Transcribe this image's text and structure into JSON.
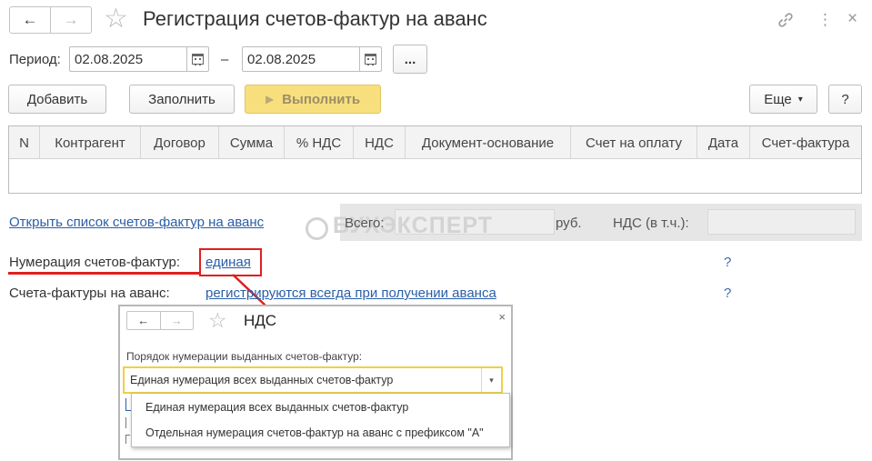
{
  "window": {
    "title": "Регистрация счетов-фактур на аванс",
    "back_icon": "←",
    "forward_icon": "→",
    "favorite_icon": "☆",
    "link_icon": "🔗",
    "more_icon": "⋮",
    "close_icon": "×"
  },
  "period": {
    "label": "Период:",
    "from": "02.08.2025",
    "separator": "–",
    "to": "02.08.2025",
    "select_button": "..."
  },
  "toolbar": {
    "add": "Добавить",
    "fill": "Заполнить",
    "run": "Выполнить",
    "run_icon": "▶",
    "more": "Еще",
    "more_arrow": "▾",
    "help": "?"
  },
  "table": {
    "columns": [
      "N",
      "Контрагент",
      "Договор",
      "Сумма",
      "% НДС",
      "НДС",
      "Документ-основание",
      "Счет на оплату",
      "Дата",
      "Счет-фактура"
    ],
    "rows": []
  },
  "open_list_link": "Открыть список счетов-фактур на аванс",
  "totals": {
    "total_label": "Всего:",
    "currency": "руб.",
    "vat_label": "НДС (в т.ч.):"
  },
  "watermark": "БУХЭКСПЕРТ",
  "numbering": {
    "label": "Нумерация счетов-фактур:",
    "value": "единая",
    "help": "?"
  },
  "advance_invoices": {
    "label": "Счета-фактуры на аванс:",
    "value": "регистрируются всегда при получении аванса",
    "help": "?"
  },
  "dialog": {
    "title": "НДС",
    "back_icon": "←",
    "forward_icon": "→",
    "favorite_icon": "☆",
    "close_icon": "×",
    "field_label": "Порядок нумерации выданных счетов-фактур:",
    "selected": "Единая нумерация всех выданных счетов-фактур",
    "arrow": "▾",
    "options": [
      "Единая нумерация всех выданных счетов-фактур",
      "Отдельная нумерация счетов-фактур на аванс с префиксом \"А\""
    ]
  },
  "colors": {
    "accent_yellow": "#f8df7e",
    "link": "#2a5ea7",
    "annotation_red": "#e01f1f",
    "combo_focus": "#f0cf45"
  }
}
